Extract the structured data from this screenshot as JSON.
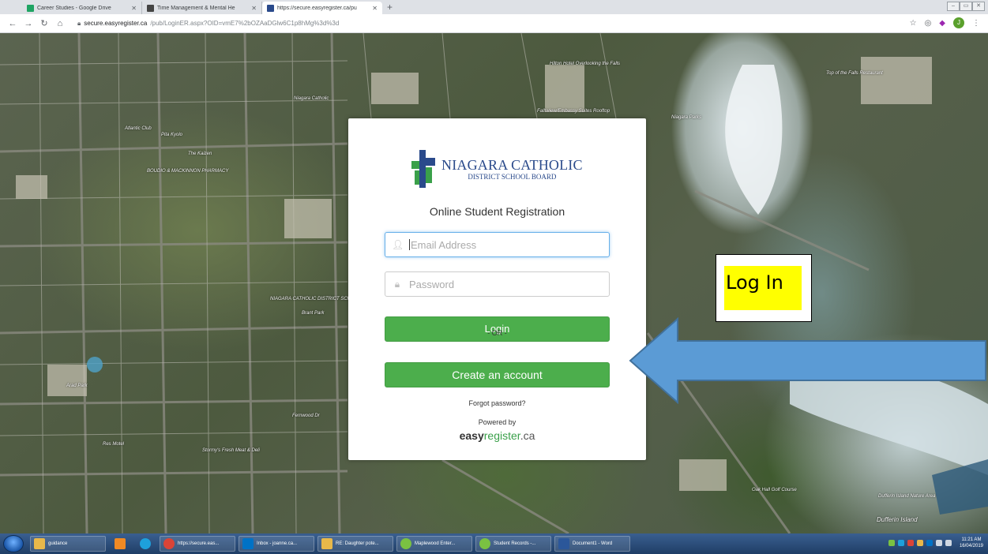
{
  "browser": {
    "tabs": [
      {
        "title": "Career Studies - Google Drive",
        "active": false,
        "favicon_color": "#1fa463"
      },
      {
        "title": "Time Management & Mental He",
        "active": false,
        "favicon_color": "#444444"
      },
      {
        "title": "https://secure.easyregister.ca/pu",
        "active": true,
        "favicon_color": "#2a4a8b"
      }
    ],
    "new_tab": "+",
    "url_domain": "secure.easyregister.ca",
    "url_path": "/pub/LoginER.aspx?OID=vmE7%2bOZAaDGlw6C1p8hMg%3d%3d",
    "profile_initial": "J"
  },
  "login": {
    "logo_line1": "NIAGARA CATHOLIC",
    "logo_line2": "DISTRICT SCHOOL BOARD",
    "subtitle": "Online Student Registration",
    "email_placeholder": "Email Address",
    "password_placeholder": "Password",
    "login_label": "Login",
    "or_label": "- OR -",
    "create_label": "Create an account",
    "forgot_label": "Forgot password?",
    "powered_label": "Powered by",
    "brand_easy": "easy",
    "brand_register": "register",
    "brand_ca": ".ca"
  },
  "annotation": {
    "text": "Log In",
    "arrow_color": "#5b9bd5"
  },
  "map_labels": [
    "Atlantic Club",
    "Pita Kyolo",
    "The Kaizen",
    "BOUDIO & MACKINNON PHARMACY",
    "Niagara Catholic",
    "NIAGARA CATHOLIC DISTRICT SCHOOL",
    "Brant Park",
    "Arad Park",
    "Fernwood Dr",
    "Res Motel",
    "Stormy's Fresh Meat & Deli",
    "Top of the Falls Restaurant",
    "Niagara Parks",
    "Oak Hall Golf Course",
    "Dufferin Island Nature Area",
    "Dufferin Island",
    "Fallsview/Embassy Suites Rooftop",
    "Hilton Hotel Overlooking the Falls"
  ],
  "taskbar": {
    "items": [
      {
        "label": "guidance",
        "color": "#e8b84a"
      },
      {
        "label": "https://secure.eas...",
        "color": "#db4437"
      },
      {
        "label": "Inbox - joanne.ca...",
        "color": "#0072c6"
      },
      {
        "label": "RE: Daughter pote...",
        "color": "#e8b84a"
      },
      {
        "label": "Maplewood Enter...",
        "color": "#7ac142"
      },
      {
        "label": "Student Records -...",
        "color": "#7ac142"
      },
      {
        "label": "Document1 - Word",
        "color": "#2b579a"
      }
    ],
    "time": "11:21 AM",
    "date": "16/04/2019"
  }
}
